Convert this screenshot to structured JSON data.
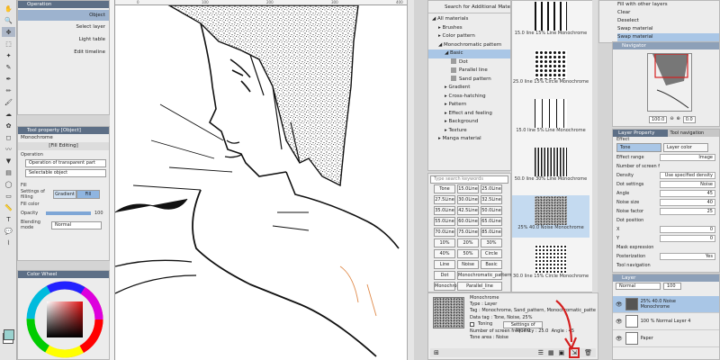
{
  "tool_palette_left": {
    "icons": [
      "hand-icon",
      "zoom-icon",
      "operation-icon",
      "selection-icon",
      "auto-select-icon",
      "eyedropper-icon",
      "pen-icon",
      "pencil-icon",
      "brush-icon",
      "airbrush-icon",
      "decoration-icon",
      "eraser-icon",
      "blend-icon",
      "fill-icon",
      "gradient-icon",
      "figure-icon",
      "frame-icon",
      "ruler-icon",
      "text-icon",
      "balloon-icon",
      "correct-line-icon"
    ]
  },
  "subtool": {
    "header": "Operation",
    "items": [
      "Object",
      "Select layer",
      "Light table",
      "Edit timeline"
    ]
  },
  "tool_property": {
    "header": "Tool property [Object]",
    "name": "Monochrome",
    "subheader": "[Fill Editing]",
    "operation_label": "Operation",
    "operation_value": "Operation of transparent part",
    "select_value": "Selectable object",
    "fill_label": "Fill",
    "settings_of_filling_label": "Settings of filling",
    "gradient_label": "Gradient",
    "fill_option_label": "Fill",
    "fill_color_label": "Fill color",
    "opacity_label": "Opacity",
    "opacity_value": "100",
    "blending_label": "Blending mode",
    "blending_value": "Normal"
  },
  "color_wheel": {
    "header": "Color Wheel"
  },
  "materials": {
    "search_label": "Search for Additional Materials",
    "tree": [
      {
        "label": "All materials",
        "level": 0
      },
      {
        "label": "Brushes",
        "level": 1
      },
      {
        "label": "Color pattern",
        "level": 1
      },
      {
        "label": "Monochromatic pattern",
        "level": 1
      },
      {
        "label": "Basic",
        "level": 2
      },
      {
        "label": "Dot",
        "level": 3
      },
      {
        "label": "Parallel line",
        "level": 3
      },
      {
        "label": "Sand pattern",
        "level": 3
      },
      {
        "label": "Gradient",
        "level": 2
      },
      {
        "label": "Cross-hatching",
        "level": 2
      },
      {
        "label": "Pattern",
        "level": 2
      },
      {
        "label": "Effect and feeling",
        "level": 2
      },
      {
        "label": "Background",
        "level": 2
      },
      {
        "label": "Texture",
        "level": 2
      },
      {
        "label": "Manga material",
        "level": 1
      }
    ],
    "search_placeholder": "Type search keywords",
    "tags": [
      "Tone",
      "15.0Line",
      "25.0Line",
      "27.5Line",
      "30.0Line",
      "32.5Line",
      "35.0Line",
      "42.5Line",
      "50.0Line",
      "55.0Line",
      "60.0Line",
      "65.0Line",
      "70.0Line",
      "75.0Line",
      "85.0Line",
      "10%",
      "20%",
      "30%",
      "40%",
      "50%",
      "Circle",
      "Line",
      "Noise",
      "Basic",
      "Dot",
      "Monochromatic_pattern",
      "Monochrome",
      "Parallel_line",
      "Sand_pattern",
      "White_tone"
    ],
    "thumbs": [
      {
        "caption": "15.0 line 15% Line Monochrome",
        "kind": "lines-wide"
      },
      {
        "caption": "25.0 line 15% Circle Monochrome",
        "kind": "dots"
      },
      {
        "caption": "15.0 line 5% Line Monochrome",
        "kind": "lines-thin"
      },
      {
        "caption": "50.0 line 30% Line Monochrome",
        "kind": "lines-dense"
      },
      {
        "caption": "25% 40.0 Noise Monochrome",
        "kind": "noise"
      },
      {
        "caption": "30.0 line 15% Circle Monochrome",
        "kind": "dots-small"
      }
    ],
    "detail": {
      "name": "Monochrome",
      "type": "Type : Layer",
      "tags": "Tag : Monochrome, Sand_pattern, Monochromatic_pattern, Basic",
      "data_tag": "Data tag : Tone, Noise, 25%",
      "toning_label": "Toning",
      "settings_of_toning": "Settings of toning",
      "screen_frequency": "Number of screen frequency : 25.0",
      "angle": "Angle : 45",
      "tone_area": "Tone area : Noise"
    }
  },
  "right_top": {
    "items": [
      "Fill with other layers",
      "Clear",
      "Deselect",
      "Swap material",
      "Swap material"
    ]
  },
  "navigator": {
    "header": "Navigator",
    "zoom": "100.0",
    "angle": "0.0"
  },
  "layer_property": {
    "header": "Layer Property",
    "tab2": "Tool navigation",
    "effect_label": "Effect",
    "tone_label": "Tone",
    "layer_color_label": "Layer color",
    "effect_range_label": "Effect range",
    "effect_range_value": "Image",
    "screen_freq_label": "Number of screen frequency",
    "density_label": "Density",
    "density_value": "Use specified density",
    "dot_settings_label": "Dot settings",
    "dot_settings_value": "Noise",
    "angle_label": "Angle",
    "angle_value": "45",
    "noise_size_label": "Noise size",
    "noise_size_value": "40",
    "noise_factor_label": "Noise factor",
    "noise_factor_value": "25",
    "dot_position_label": "Dot position",
    "x_label": "X",
    "x_value": "0",
    "y_label": "Y",
    "y_value": "0",
    "mask_label": "Mask expression",
    "posterization_label": "Posterization",
    "posterization_value": "Yes",
    "tool_navigation_label": "Tool navigation"
  },
  "layers": {
    "header": "Layer",
    "blend": "Normal",
    "opacity": "100",
    "list": [
      {
        "name": "25% 40.0 Noise Monochrome",
        "selected": true
      },
      {
        "name": "100 % Normal Layer 4",
        "selected": false
      },
      {
        "name": "Paper",
        "selected": false
      }
    ]
  },
  "ruler_numbers": [
    "0",
    "100",
    "200",
    "300",
    "400"
  ],
  "accent": "#d42020"
}
